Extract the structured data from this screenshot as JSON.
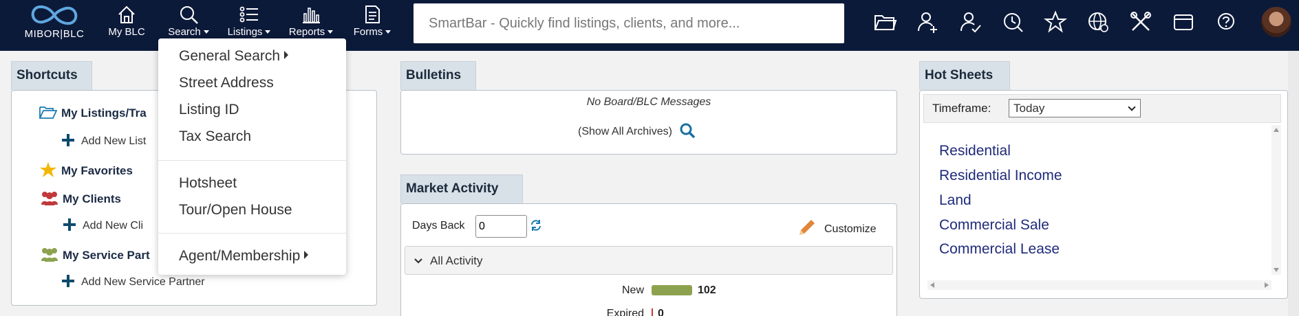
{
  "app": {
    "logo_text": "MIBOR|BLC"
  },
  "nav": {
    "my_blc": "My BLC",
    "search": "Search",
    "listings": "Listings",
    "reports": "Reports",
    "forms": "Forms"
  },
  "smartbar": {
    "placeholder": "SmartBar - Quickly find listings, clients, and more..."
  },
  "toolbar_icons": [
    "folder-icon",
    "add-contact-icon",
    "contact-check-icon",
    "history-icon",
    "star-icon",
    "globe-icon",
    "tools-icon",
    "wallet-icon",
    "help-icon"
  ],
  "search_menu": {
    "items": [
      "General Search",
      "Street Address",
      "Listing ID",
      "Tax Search",
      "Hotsheet",
      "Tour/Open House",
      "Agent/Membership"
    ]
  },
  "shortcuts": {
    "title": "Shortcuts",
    "my_listings": "My Listings/Tra",
    "add_new_listing": "Add New List",
    "my_favorites": "My Favorites",
    "my_clients": "My Clients",
    "add_new_client": "Add New Cli",
    "my_service_partners": "My Service Part",
    "add_new_service_partner": "Add New Service Partner"
  },
  "bulletins": {
    "title": "Bulletins",
    "no_messages": "No Board/BLC Messages",
    "show_archives": "(Show All Archives)"
  },
  "market_activity": {
    "title": "Market Activity",
    "days_back_label": "Days Back",
    "days_back_value": "0",
    "customize": "Customize",
    "all_activity": "All Activity",
    "rows": [
      {
        "label": "New",
        "value": "102",
        "color": "#8da24f"
      },
      {
        "label": "Expired",
        "value": "0",
        "color": "#c0392b"
      }
    ]
  },
  "hot_sheets": {
    "title": "Hot Sheets",
    "timeframe_label": "Timeframe:",
    "timeframe_value": "Today",
    "links": [
      "Residential",
      "Residential Income",
      "Land",
      "Commercial Sale",
      "Commercial Lease"
    ]
  },
  "colors": {
    "topbar": "#0c1a3a",
    "link": "#1f2a7a",
    "accent_icon": "#1a7ab0"
  }
}
